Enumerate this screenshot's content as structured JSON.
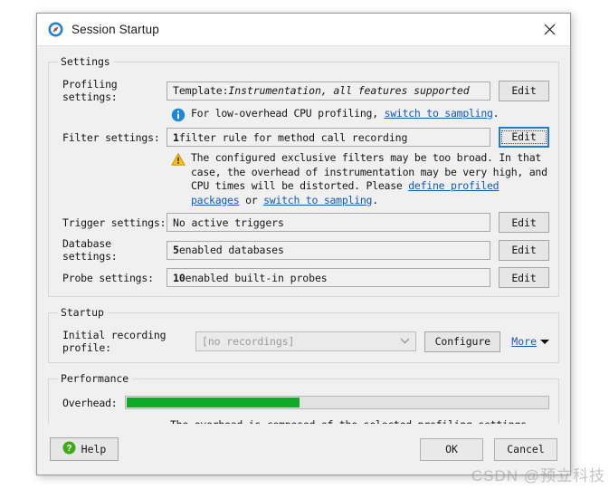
{
  "window": {
    "title": "Session Startup",
    "icon": "compass-icon",
    "close_label": "close-icon"
  },
  "settings": {
    "legend": "Settings",
    "profiling": {
      "label": "Profiling settings:",
      "value_prefix": "Template: ",
      "value_em": "Instrumentation, all features supported",
      "button": "Edit"
    },
    "info_note": {
      "icon": "info-icon",
      "text_before": "For low-overhead CPU profiling, ",
      "link": "switch to sampling",
      "text_after": "."
    },
    "filter": {
      "label": "Filter settings:",
      "value_bold": "1",
      "value_rest": " filter rule for method call recording",
      "button": "Edit"
    },
    "warning_note": {
      "icon": "warning-icon",
      "text_1": "The configured exclusive filters may be too broad. In that case, the overhead of instrumentation may be very high, and CPU times will be distorted. Please ",
      "link_1": "define profiled packages",
      "text_2": " or ",
      "link_2": "switch to sampling",
      "text_3": "."
    },
    "trigger": {
      "label": "Trigger settings:",
      "value": "No active triggers",
      "button": "Edit"
    },
    "database": {
      "label": "Database settings:",
      "value_bold": "5",
      "value_rest": " enabled databases",
      "button": "Edit"
    },
    "probe": {
      "label": "Probe settings:",
      "value_bold": "10",
      "value_rest": " enabled built-in probes",
      "button": "Edit"
    }
  },
  "startup": {
    "legend": "Startup",
    "profile_label": "Initial recording profile:",
    "profile_value": "[no recordings]",
    "configure_button": "Configure",
    "more_link": "More"
  },
  "performance": {
    "legend": "Performance",
    "overhead_label": "Overhead:",
    "overhead_percent": 41,
    "description": "The overhead is composed of the selected profiling settings and the selected recording profile."
  },
  "footer": {
    "help": "Help",
    "ok": "OK",
    "cancel": "Cancel"
  },
  "watermark": "CSDN @预立科技",
  "colors": {
    "accent_blue": "#1a7fd4",
    "link_blue": "#1459b8",
    "progress_green": "#0eaa28",
    "warning_amber": "#f0b400",
    "help_green": "#3faa16"
  }
}
